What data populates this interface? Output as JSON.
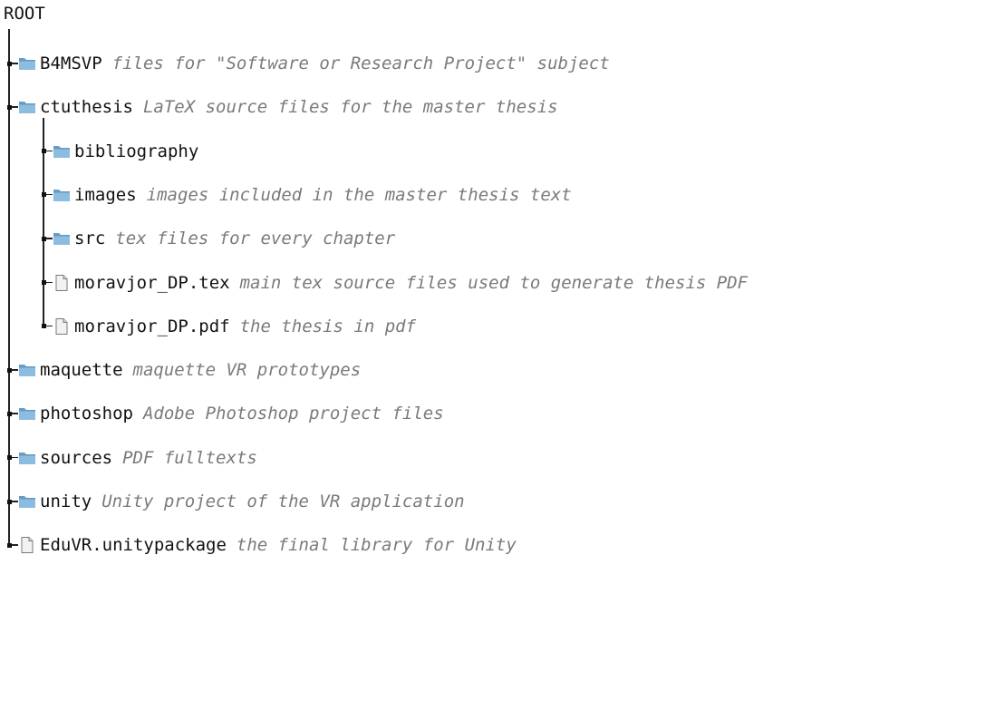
{
  "root": {
    "label": "ROOT"
  },
  "entries": [
    {
      "name": "B4MSVP",
      "desc": "files for \"Software or Research Project\" subject",
      "kind": "folder-icon",
      "depth": 0
    },
    {
      "name": "ctuthesis",
      "desc": "LaTeX source files for the master thesis",
      "kind": "folder-icon",
      "depth": 0
    },
    {
      "name": "bibliography",
      "desc": "",
      "kind": "folder-icon",
      "depth": 1
    },
    {
      "name": "images",
      "desc": "images included in the master thesis text",
      "kind": "folder-icon",
      "depth": 1
    },
    {
      "name": "src",
      "desc": "tex files for every chapter",
      "kind": "folder-icon",
      "depth": 1
    },
    {
      "name": "moravjor_DP.tex",
      "desc": "main tex source files used to generate thesis PDF",
      "kind": "file-icon",
      "depth": 1
    },
    {
      "name": "moravjor_DP.pdf",
      "desc": "the thesis in pdf",
      "kind": "file-icon",
      "depth": 1
    },
    {
      "name": "maquette",
      "desc": "maquette VR prototypes",
      "kind": "folder-icon",
      "depth": 0
    },
    {
      "name": "photoshop",
      "desc": "Adobe Photoshop project files",
      "kind": "folder-icon",
      "depth": 0
    },
    {
      "name": "sources",
      "desc": "PDF fulltexts",
      "kind": "folder-icon",
      "depth": 0
    },
    {
      "name": "unity",
      "desc": "Unity project of the VR application",
      "kind": "folder-icon",
      "depth": 0
    },
    {
      "name": "EduVR.unitypackage",
      "desc": "the final library for Unity",
      "kind": "file-icon",
      "depth": 0
    }
  ]
}
